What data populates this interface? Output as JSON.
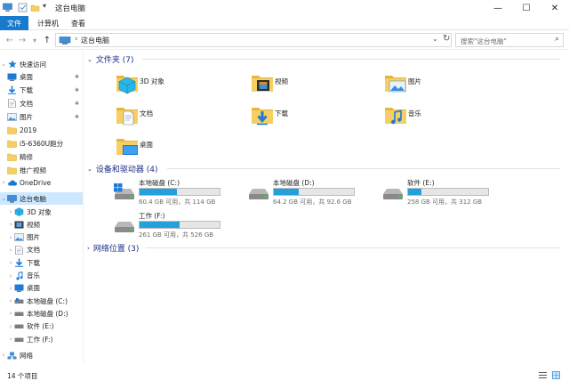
{
  "window": {
    "title": "这台电脑",
    "controls": {
      "minimize": "—",
      "maximize": "☐",
      "close": "✕"
    }
  },
  "ribbon": {
    "tabs": [
      "文件",
      "计算机",
      "查看"
    ]
  },
  "address": {
    "path": "这台电脑",
    "search_placeholder": "搜索\"这台电脑\""
  },
  "nav": {
    "quick_access": "快速访问",
    "quick_items": [
      "桌面",
      "下载",
      "文档",
      "图片",
      "2019",
      "i5-6360U跑分",
      "精修",
      "推广视频"
    ],
    "onedrive": "OneDrive",
    "this_pc": "这台电脑",
    "pc_items": [
      "3D 对象",
      "视频",
      "图片",
      "文档",
      "下载",
      "音乐",
      "桌面",
      "本地磁盘 (C:)",
      "本地磁盘 (D:)",
      "软件 (E:)",
      "工作 (F:)"
    ],
    "network": "网络"
  },
  "main": {
    "folders_header": "文件夹 (7)",
    "folders": [
      {
        "label": "3D 对象",
        "icon": "3d-objects-icon"
      },
      {
        "label": "视频",
        "icon": "video-folder-icon"
      },
      {
        "label": "图片",
        "icon": "pictures-folder-icon"
      },
      {
        "label": "文档",
        "icon": "documents-folder-icon"
      },
      {
        "label": "下载",
        "icon": "downloads-folder-icon"
      },
      {
        "label": "音乐",
        "icon": "music-folder-icon"
      },
      {
        "label": "桌面",
        "icon": "desktop-folder-icon"
      }
    ],
    "drives_header": "设备和驱动器 (4)",
    "drives": [
      {
        "name": "本地磁盘 (C:)",
        "size": "60.4 GB 可用，共 114 GB",
        "used_fraction": 0.47,
        "system": true
      },
      {
        "name": "本地磁盘 (D:)",
        "size": "64.2 GB 可用，共 92.6 GB",
        "used_fraction": 0.31
      },
      {
        "name": "软件 (E:)",
        "size": "258 GB 可用，共 312 GB",
        "used_fraction": 0.17
      },
      {
        "name": "工作 (F:)",
        "size": "261 GB 可用，共 526 GB",
        "used_fraction": 0.5
      }
    ],
    "network_header": "网络位置 (3)"
  },
  "status": {
    "count": "14 个项目"
  },
  "colors": {
    "accent": "#1979ca",
    "selection": "#cce8ff",
    "bar_fill": "#26a0da",
    "folder": "#f5cf63"
  }
}
